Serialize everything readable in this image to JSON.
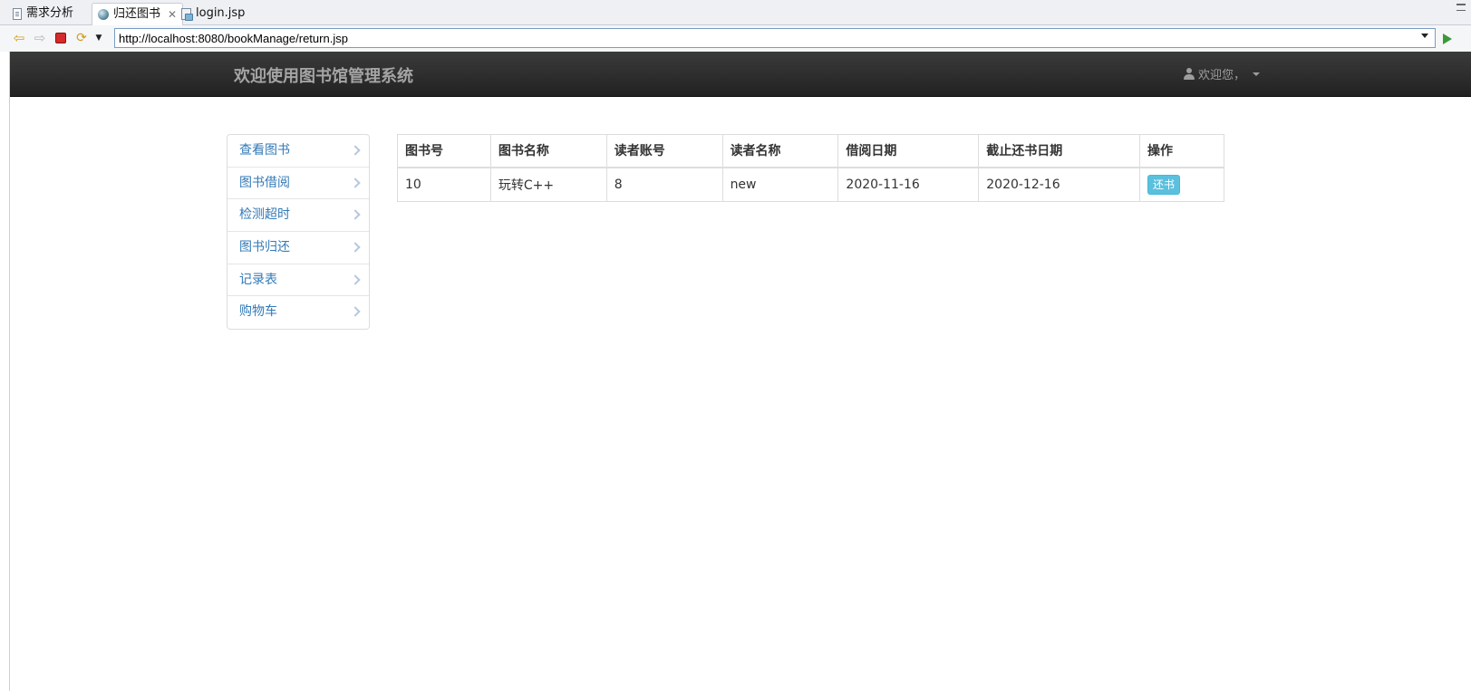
{
  "tabs": [
    {
      "label": "需求分析",
      "icon": "document-icon"
    },
    {
      "label": "归还图书",
      "icon": "globe-icon",
      "active": true
    },
    {
      "label": "login.jsp",
      "icon": "jsp-file-icon"
    }
  ],
  "toolbar": {
    "url": "http://localhost:8080/bookManage/return.jsp"
  },
  "navbar": {
    "brand": "欢迎使用图书馆管理系统",
    "user_label": "欢迎您，"
  },
  "sidebar": {
    "items": [
      {
        "label": "查看图书"
      },
      {
        "label": "图书借阅"
      },
      {
        "label": "检测超时"
      },
      {
        "label": "图书归还"
      },
      {
        "label": "记录表"
      },
      {
        "label": "购物车"
      }
    ]
  },
  "table": {
    "headers": [
      "图书号",
      "图书名称",
      "读者账号",
      "读者名称",
      "借阅日期",
      "截止还书日期",
      "操作"
    ],
    "rows": [
      {
        "book_id": "10",
        "book_name": "玩转C++",
        "reader_account": "8",
        "reader_name": "new",
        "borrow_date": "2020-11-16",
        "due_date": "2020-12-16",
        "action_label": "还书"
      }
    ]
  },
  "colors": {
    "navbar": "#222222",
    "link": "#337ab7",
    "info_button": "#5bc0de"
  }
}
